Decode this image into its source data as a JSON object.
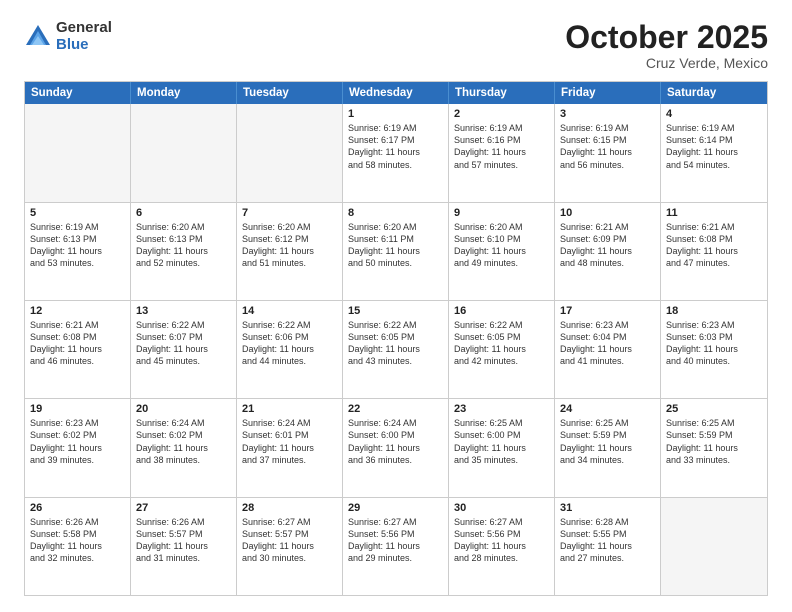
{
  "logo": {
    "general": "General",
    "blue": "Blue"
  },
  "header": {
    "month": "October 2025",
    "location": "Cruz Verde, Mexico"
  },
  "weekdays": [
    "Sunday",
    "Monday",
    "Tuesday",
    "Wednesday",
    "Thursday",
    "Friday",
    "Saturday"
  ],
  "rows": [
    [
      {
        "day": "",
        "empty": true
      },
      {
        "day": "",
        "empty": true
      },
      {
        "day": "",
        "empty": true
      },
      {
        "day": "1",
        "lines": [
          "Sunrise: 6:19 AM",
          "Sunset: 6:17 PM",
          "Daylight: 11 hours",
          "and 58 minutes."
        ]
      },
      {
        "day": "2",
        "lines": [
          "Sunrise: 6:19 AM",
          "Sunset: 6:16 PM",
          "Daylight: 11 hours",
          "and 57 minutes."
        ]
      },
      {
        "day": "3",
        "lines": [
          "Sunrise: 6:19 AM",
          "Sunset: 6:15 PM",
          "Daylight: 11 hours",
          "and 56 minutes."
        ]
      },
      {
        "day": "4",
        "lines": [
          "Sunrise: 6:19 AM",
          "Sunset: 6:14 PM",
          "Daylight: 11 hours",
          "and 54 minutes."
        ]
      }
    ],
    [
      {
        "day": "5",
        "lines": [
          "Sunrise: 6:19 AM",
          "Sunset: 6:13 PM",
          "Daylight: 11 hours",
          "and 53 minutes."
        ]
      },
      {
        "day": "6",
        "lines": [
          "Sunrise: 6:20 AM",
          "Sunset: 6:13 PM",
          "Daylight: 11 hours",
          "and 52 minutes."
        ]
      },
      {
        "day": "7",
        "lines": [
          "Sunrise: 6:20 AM",
          "Sunset: 6:12 PM",
          "Daylight: 11 hours",
          "and 51 minutes."
        ]
      },
      {
        "day": "8",
        "lines": [
          "Sunrise: 6:20 AM",
          "Sunset: 6:11 PM",
          "Daylight: 11 hours",
          "and 50 minutes."
        ]
      },
      {
        "day": "9",
        "lines": [
          "Sunrise: 6:20 AM",
          "Sunset: 6:10 PM",
          "Daylight: 11 hours",
          "and 49 minutes."
        ]
      },
      {
        "day": "10",
        "lines": [
          "Sunrise: 6:21 AM",
          "Sunset: 6:09 PM",
          "Daylight: 11 hours",
          "and 48 minutes."
        ]
      },
      {
        "day": "11",
        "lines": [
          "Sunrise: 6:21 AM",
          "Sunset: 6:08 PM",
          "Daylight: 11 hours",
          "and 47 minutes."
        ]
      }
    ],
    [
      {
        "day": "12",
        "lines": [
          "Sunrise: 6:21 AM",
          "Sunset: 6:08 PM",
          "Daylight: 11 hours",
          "and 46 minutes."
        ]
      },
      {
        "day": "13",
        "lines": [
          "Sunrise: 6:22 AM",
          "Sunset: 6:07 PM",
          "Daylight: 11 hours",
          "and 45 minutes."
        ]
      },
      {
        "day": "14",
        "lines": [
          "Sunrise: 6:22 AM",
          "Sunset: 6:06 PM",
          "Daylight: 11 hours",
          "and 44 minutes."
        ]
      },
      {
        "day": "15",
        "lines": [
          "Sunrise: 6:22 AM",
          "Sunset: 6:05 PM",
          "Daylight: 11 hours",
          "and 43 minutes."
        ]
      },
      {
        "day": "16",
        "lines": [
          "Sunrise: 6:22 AM",
          "Sunset: 6:05 PM",
          "Daylight: 11 hours",
          "and 42 minutes."
        ]
      },
      {
        "day": "17",
        "lines": [
          "Sunrise: 6:23 AM",
          "Sunset: 6:04 PM",
          "Daylight: 11 hours",
          "and 41 minutes."
        ]
      },
      {
        "day": "18",
        "lines": [
          "Sunrise: 6:23 AM",
          "Sunset: 6:03 PM",
          "Daylight: 11 hours",
          "and 40 minutes."
        ]
      }
    ],
    [
      {
        "day": "19",
        "lines": [
          "Sunrise: 6:23 AM",
          "Sunset: 6:02 PM",
          "Daylight: 11 hours",
          "and 39 minutes."
        ]
      },
      {
        "day": "20",
        "lines": [
          "Sunrise: 6:24 AM",
          "Sunset: 6:02 PM",
          "Daylight: 11 hours",
          "and 38 minutes."
        ]
      },
      {
        "day": "21",
        "lines": [
          "Sunrise: 6:24 AM",
          "Sunset: 6:01 PM",
          "Daylight: 11 hours",
          "and 37 minutes."
        ]
      },
      {
        "day": "22",
        "lines": [
          "Sunrise: 6:24 AM",
          "Sunset: 6:00 PM",
          "Daylight: 11 hours",
          "and 36 minutes."
        ]
      },
      {
        "day": "23",
        "lines": [
          "Sunrise: 6:25 AM",
          "Sunset: 6:00 PM",
          "Daylight: 11 hours",
          "and 35 minutes."
        ]
      },
      {
        "day": "24",
        "lines": [
          "Sunrise: 6:25 AM",
          "Sunset: 5:59 PM",
          "Daylight: 11 hours",
          "and 34 minutes."
        ]
      },
      {
        "day": "25",
        "lines": [
          "Sunrise: 6:25 AM",
          "Sunset: 5:59 PM",
          "Daylight: 11 hours",
          "and 33 minutes."
        ]
      }
    ],
    [
      {
        "day": "26",
        "lines": [
          "Sunrise: 6:26 AM",
          "Sunset: 5:58 PM",
          "Daylight: 11 hours",
          "and 32 minutes."
        ]
      },
      {
        "day": "27",
        "lines": [
          "Sunrise: 6:26 AM",
          "Sunset: 5:57 PM",
          "Daylight: 11 hours",
          "and 31 minutes."
        ]
      },
      {
        "day": "28",
        "lines": [
          "Sunrise: 6:27 AM",
          "Sunset: 5:57 PM",
          "Daylight: 11 hours",
          "and 30 minutes."
        ]
      },
      {
        "day": "29",
        "lines": [
          "Sunrise: 6:27 AM",
          "Sunset: 5:56 PM",
          "Daylight: 11 hours",
          "and 29 minutes."
        ]
      },
      {
        "day": "30",
        "lines": [
          "Sunrise: 6:27 AM",
          "Sunset: 5:56 PM",
          "Daylight: 11 hours",
          "and 28 minutes."
        ]
      },
      {
        "day": "31",
        "lines": [
          "Sunrise: 6:28 AM",
          "Sunset: 5:55 PM",
          "Daylight: 11 hours",
          "and 27 minutes."
        ]
      },
      {
        "day": "",
        "empty": true
      }
    ]
  ]
}
